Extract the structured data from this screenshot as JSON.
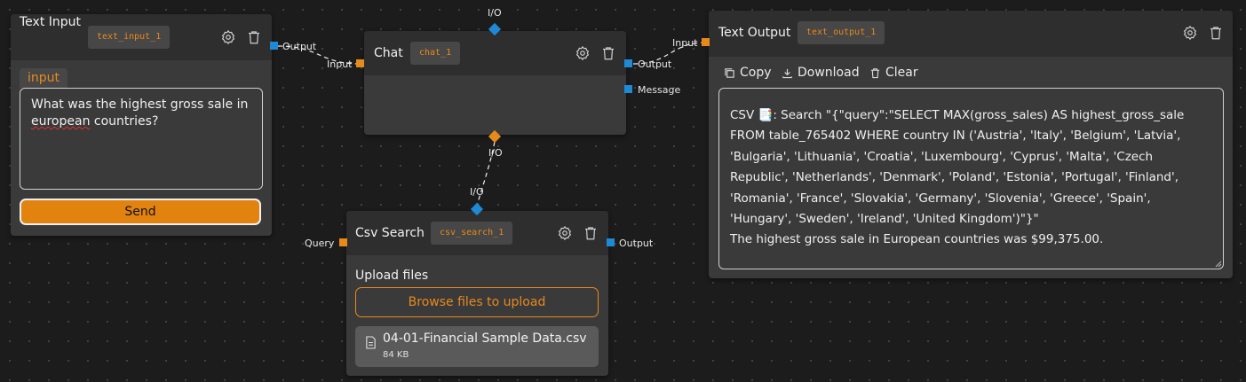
{
  "nodes": {
    "text_input": {
      "title": "Text Input",
      "id": "text_input_1",
      "tab_label": "input",
      "input_value_line1": "What was the highest gross sale in",
      "input_value_word": "european",
      "input_value_rest": " countries?",
      "send_label": "Send",
      "output_port_label": "Output"
    },
    "chat": {
      "title": "Chat",
      "id": "chat_1",
      "input_port_label": "Input",
      "output_port_label": "Output",
      "message_port_label": "Message",
      "io_top_label": "I/O",
      "io_bottom_label": "I/O"
    },
    "csv_search": {
      "title": "Csv Search",
      "id": "csv_search_1",
      "query_port_label": "Query",
      "output_port_label": "Output",
      "io_top_label": "I/O",
      "upload_label": "Upload files",
      "browse_label": "Browse files to upload",
      "file_name": "04-01-Financial Sample Data.csv",
      "file_size": "84 KB"
    },
    "text_output": {
      "title": "Text Output",
      "id": "text_output_1",
      "input_port_label": "Input",
      "copy_label": "Copy",
      "download_label": "Download",
      "clear_label": "Clear",
      "output_text": "CSV 📑: Search \"{\"query\":\"SELECT MAX(gross_sales) AS highest_gross_sale FROM table_765402 WHERE country IN ('Austria', 'Italy', 'Belgium', 'Latvia', 'Bulgaria', 'Lithuania', 'Croatia', 'Luxembourg', 'Cyprus', 'Malta', 'Czech Republic', 'Netherlands', 'Denmark', 'Poland', 'Estonia', 'Portugal', 'Finland', 'Romania', 'France', 'Slovakia', 'Germany', 'Slovenia', 'Greece', 'Spain', 'Hungary', 'Sweden', 'Ireland', 'United Kingdom')\"}\"\nThe highest gross sale in European countries was $99,375.00."
    }
  },
  "icons": [
    "gear-icon",
    "trash-icon",
    "copy-icon",
    "download-icon",
    "file-icon"
  ],
  "colors": {
    "accent": "#e8891c",
    "port_blue": "#1e8ad6",
    "node_bg": "#3a3a3a",
    "canvas_bg": "#1c1c1c"
  }
}
